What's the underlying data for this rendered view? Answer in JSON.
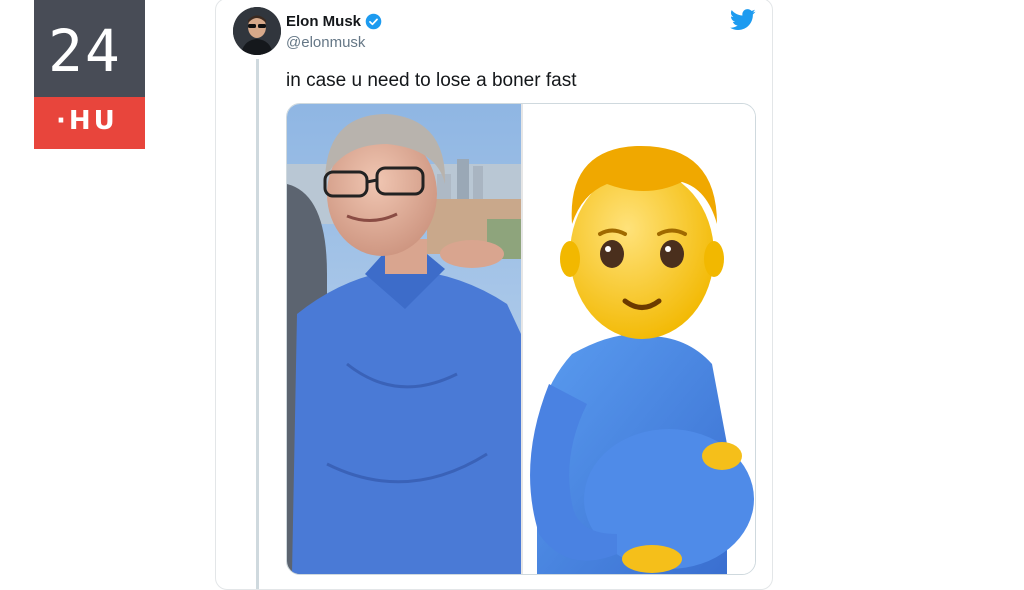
{
  "logo": {
    "number": "24",
    "suffix": "·HU",
    "colors": {
      "top": "#484c56",
      "bottom": "#e8453c"
    }
  },
  "tweet": {
    "author_name": "Elon Musk",
    "author_handle": "@elonmusk",
    "verified": true,
    "text": "in case u need to lose a boner fast",
    "brand_icon": "twitter-bird-icon",
    "media": {
      "left_panel": "photo of a man in a blue polo shirt",
      "right_panel": "pregnant man emoji in blue shirt"
    },
    "colors": {
      "accent": "#1d9bf0",
      "shirt": "#4a7ad6"
    }
  }
}
